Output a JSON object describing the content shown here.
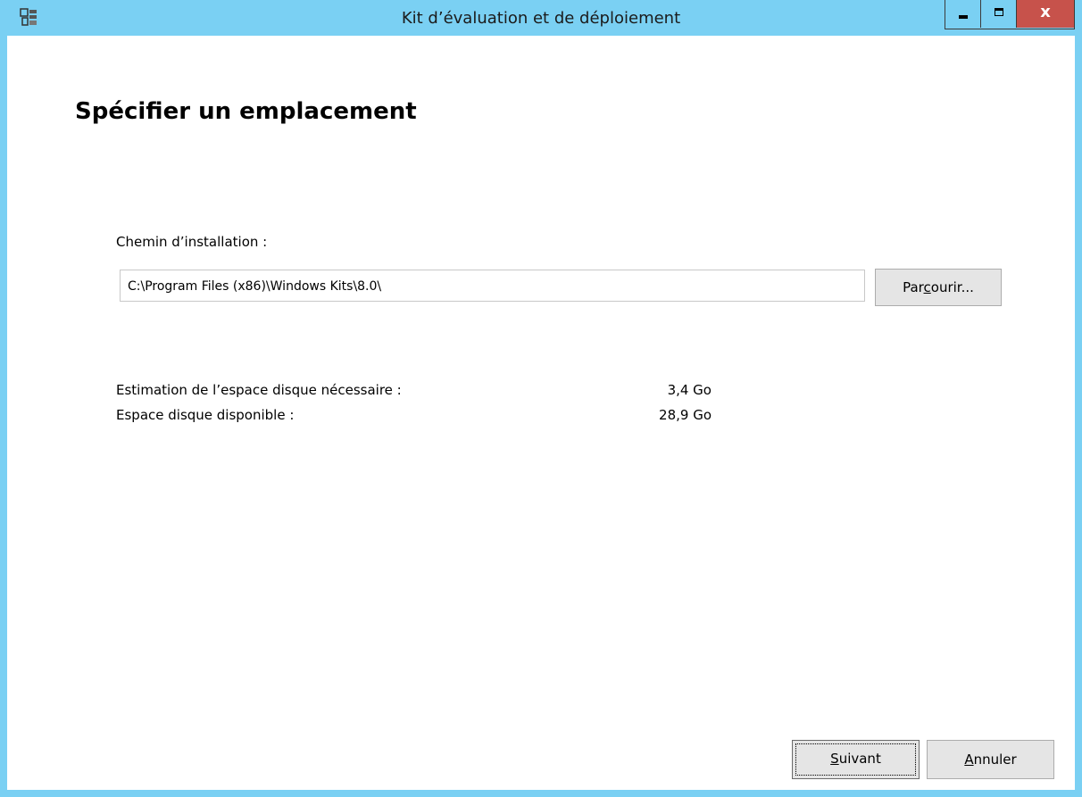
{
  "window": {
    "title": "Kit d’évaluation et de déploiement",
    "minimize_icon": "minimize-icon",
    "maximize_icon": "maximize-icon",
    "close_glyph": "x"
  },
  "page": {
    "heading": "Spécifier un emplacement",
    "install_path_label": "Chemin d’installation :",
    "install_path_value": "C:\\Program Files (x86)\\Windows Kits\\8.0\\",
    "browse_button": {
      "pre": "Par",
      "accel": "c",
      "post": "ourir..."
    }
  },
  "disk": {
    "required_label": "Estimation de l’espace disque nécessaire :",
    "required_value": "3,4 Go",
    "available_label": "Espace disque disponible :",
    "available_value": "28,9 Go"
  },
  "footer": {
    "next_button": {
      "accel": "S",
      "rest": "uivant"
    },
    "cancel_button": {
      "accel": "A",
      "rest": "nnuler"
    }
  },
  "colors": {
    "titlebar": "#7ad0f3",
    "close": "#c7524b",
    "button": "#e5e5e5"
  }
}
